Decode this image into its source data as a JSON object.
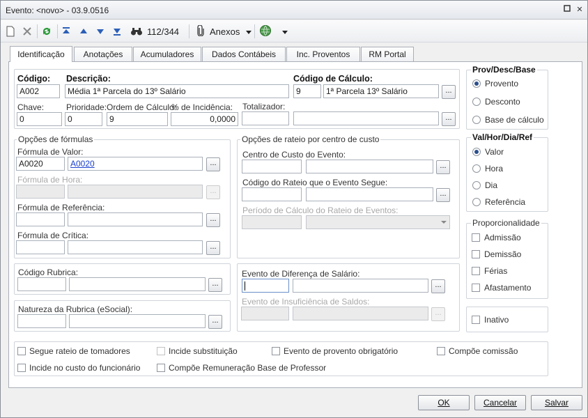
{
  "window": {
    "title": "Evento: <novo> - 03.9.0516"
  },
  "toolbar": {
    "counter": "112/344",
    "attachments": "Anexos"
  },
  "tabs": [
    "Identificação",
    "Anotações",
    "Acumuladores",
    "Dados Contábeis",
    "Inc. Proventos",
    "RM Portal"
  ],
  "ident": {
    "codigo_label": "Código:",
    "codigo": "A002",
    "descricao_label": "Descrição:",
    "descricao": "Média 1ª Parcela do 13º Salário",
    "calc_label": "Código de Cálculo:",
    "calc_code": "9",
    "calc_desc": "1ª Parcela 13º Salário",
    "chave_label": "Chave:",
    "chave": "0",
    "prioridade_label": "Prioridade:",
    "prioridade": "0",
    "ordem_label": "Ordem de Cálculo:",
    "ordem": "9",
    "incid_label": "% de Incidência:",
    "incid": "0,0000",
    "totalizador_label": "Totalizador:"
  },
  "formulas": {
    "title": "Opções de fórmulas",
    "valor_label": "Fórmula de Valor:",
    "valor_code": "A0020",
    "valor_link": "A0020",
    "hora_label": "Fórmula de Hora:",
    "ref_label": "Fórmula de Referência:",
    "critica_label": "Fórmula de Crítica:"
  },
  "rateio": {
    "title": "Opções de rateio por centro de custo",
    "centro_label": "Centro de Custo do Evento:",
    "codigo_label": "Código do Rateio que o Evento Segue:",
    "periodo_label": "Período de Cálculo do Rateio de Eventos:"
  },
  "rubrica": {
    "codigo_label": "Código Rubrica:",
    "natureza_label": "Natureza da Rubrica (eSocial):"
  },
  "diferenca": {
    "dif_label": "Evento de Diferença de Salário:",
    "insuf_label": "Evento de Insuficiência de Saldos:"
  },
  "prov": {
    "title": "Prov/Desc/Base",
    "options": [
      "Provento",
      "Desconto",
      "Base de cálculo"
    ],
    "selected": 0
  },
  "val": {
    "title": "Val/Hor/Dia/Ref",
    "options": [
      "Valor",
      "Hora",
      "Dia",
      "Referência"
    ],
    "selected": 0
  },
  "prop": {
    "title": "Proporcionalidade",
    "options": [
      "Admissão",
      "Demissão",
      "Férias",
      "Afastamento"
    ]
  },
  "inativo": "Inativo",
  "bottom_checks": [
    "Segue rateio de tomadores",
    "Incide substituição",
    "Evento de provento obrigatório",
    "Compõe comissão",
    "Incide no custo do funcionário",
    "Compõe Remuneração Base de Professor"
  ],
  "buttons": {
    "ok": "OK",
    "cancel": "Cancelar",
    "save": "Salvar"
  },
  "colors": {
    "accent": "#2b4f8c",
    "link": "#1a3fd0"
  }
}
